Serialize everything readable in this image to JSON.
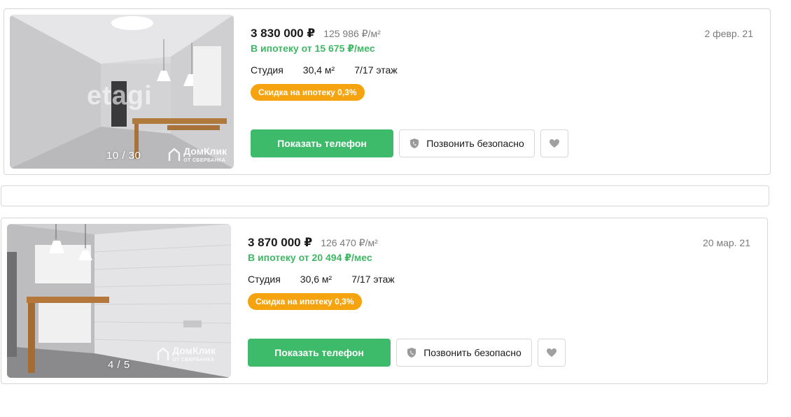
{
  "listings": [
    {
      "price": "3 830 000 ₽",
      "price_per_m2": "125 986 ₽/м²",
      "mortgage": "В ипотеку от 15 675 ₽/мес",
      "type": "Студия",
      "area": "30,4 м²",
      "floor": "7/17 этаж",
      "badge": "Скидка на ипотеку 0,3%",
      "date": "2 февр. 21",
      "photo_counter": "10 / 30",
      "watermark_top": "etagi",
      "watermark_logo": "ДомКлик",
      "watermark_logo_sub": "ОТ СБЕРБАНКА",
      "show_phone_label": "Показать телефон",
      "safe_call_label": "Позвонить безопасно"
    },
    {
      "price": "3 870 000 ₽",
      "price_per_m2": "126 470 ₽/м²",
      "mortgage": "В ипотеку от 20 494 ₽/мес",
      "type": "Студия",
      "area": "30,6 м²",
      "floor": "7/17 этаж",
      "badge": "Скидка на ипотеку 0,3%",
      "date": "20 мар. 21",
      "photo_counter": "4 / 5",
      "watermark_logo": "ДомКлик",
      "watermark_logo_sub": "ОТ СБЕРБАНКА",
      "show_phone_label": "Показать телефон",
      "safe_call_label": "Позвонить безопасно"
    }
  ],
  "icons": {
    "safe_call": "shield-phone-icon",
    "favorite": "heart-icon"
  },
  "colors": {
    "primary_green": "#3dbb6a",
    "mortgage_green": "#3fb764",
    "badge_orange": "#f5a40f"
  }
}
